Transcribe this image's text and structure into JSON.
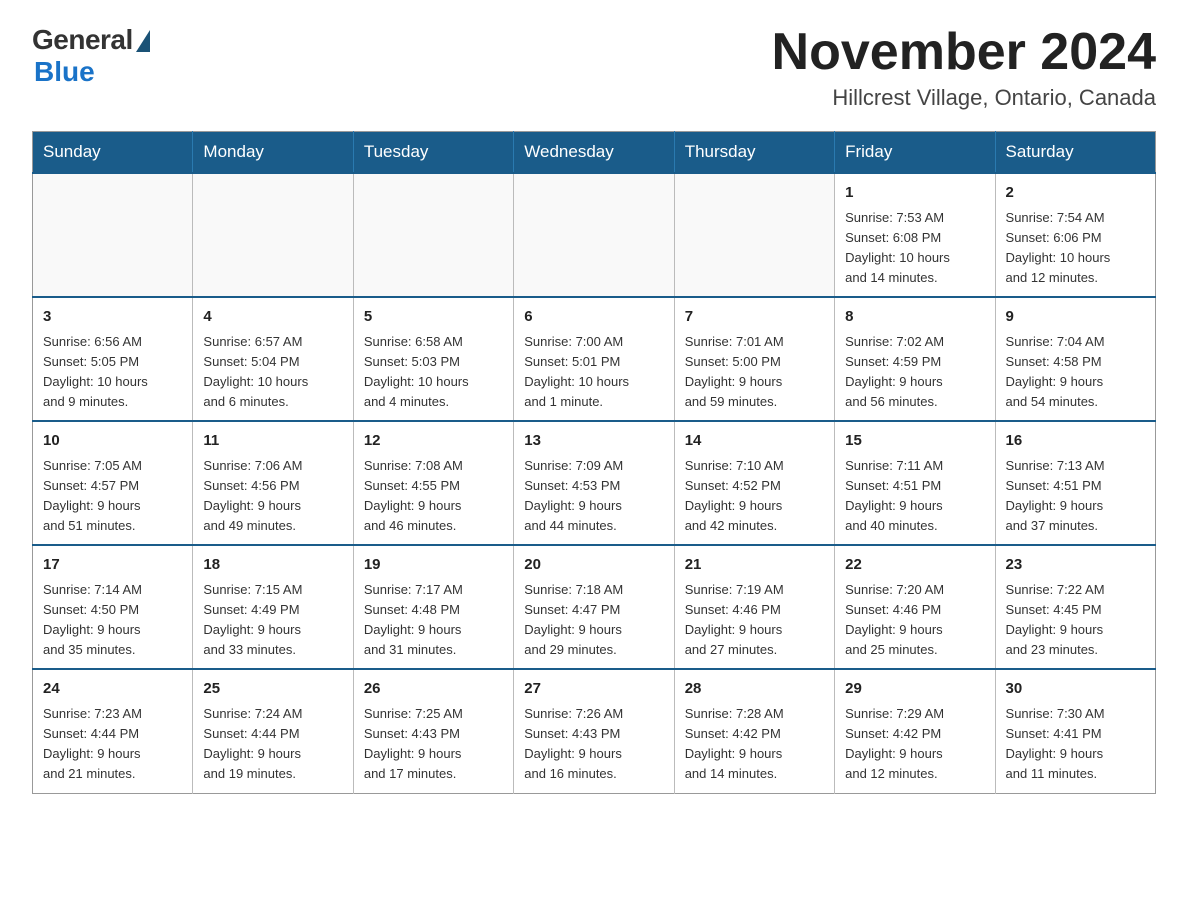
{
  "header": {
    "logo_general": "General",
    "logo_blue": "Blue",
    "month_title": "November 2024",
    "location": "Hillcrest Village, Ontario, Canada"
  },
  "weekdays": [
    "Sunday",
    "Monday",
    "Tuesday",
    "Wednesday",
    "Thursday",
    "Friday",
    "Saturday"
  ],
  "rows": [
    [
      {
        "day": "",
        "info": ""
      },
      {
        "day": "",
        "info": ""
      },
      {
        "day": "",
        "info": ""
      },
      {
        "day": "",
        "info": ""
      },
      {
        "day": "",
        "info": ""
      },
      {
        "day": "1",
        "info": "Sunrise: 7:53 AM\nSunset: 6:08 PM\nDaylight: 10 hours\nand 14 minutes."
      },
      {
        "day": "2",
        "info": "Sunrise: 7:54 AM\nSunset: 6:06 PM\nDaylight: 10 hours\nand 12 minutes."
      }
    ],
    [
      {
        "day": "3",
        "info": "Sunrise: 6:56 AM\nSunset: 5:05 PM\nDaylight: 10 hours\nand 9 minutes."
      },
      {
        "day": "4",
        "info": "Sunrise: 6:57 AM\nSunset: 5:04 PM\nDaylight: 10 hours\nand 6 minutes."
      },
      {
        "day": "5",
        "info": "Sunrise: 6:58 AM\nSunset: 5:03 PM\nDaylight: 10 hours\nand 4 minutes."
      },
      {
        "day": "6",
        "info": "Sunrise: 7:00 AM\nSunset: 5:01 PM\nDaylight: 10 hours\nand 1 minute."
      },
      {
        "day": "7",
        "info": "Sunrise: 7:01 AM\nSunset: 5:00 PM\nDaylight: 9 hours\nand 59 minutes."
      },
      {
        "day": "8",
        "info": "Sunrise: 7:02 AM\nSunset: 4:59 PM\nDaylight: 9 hours\nand 56 minutes."
      },
      {
        "day": "9",
        "info": "Sunrise: 7:04 AM\nSunset: 4:58 PM\nDaylight: 9 hours\nand 54 minutes."
      }
    ],
    [
      {
        "day": "10",
        "info": "Sunrise: 7:05 AM\nSunset: 4:57 PM\nDaylight: 9 hours\nand 51 minutes."
      },
      {
        "day": "11",
        "info": "Sunrise: 7:06 AM\nSunset: 4:56 PM\nDaylight: 9 hours\nand 49 minutes."
      },
      {
        "day": "12",
        "info": "Sunrise: 7:08 AM\nSunset: 4:55 PM\nDaylight: 9 hours\nand 46 minutes."
      },
      {
        "day": "13",
        "info": "Sunrise: 7:09 AM\nSunset: 4:53 PM\nDaylight: 9 hours\nand 44 minutes."
      },
      {
        "day": "14",
        "info": "Sunrise: 7:10 AM\nSunset: 4:52 PM\nDaylight: 9 hours\nand 42 minutes."
      },
      {
        "day": "15",
        "info": "Sunrise: 7:11 AM\nSunset: 4:51 PM\nDaylight: 9 hours\nand 40 minutes."
      },
      {
        "day": "16",
        "info": "Sunrise: 7:13 AM\nSunset: 4:51 PM\nDaylight: 9 hours\nand 37 minutes."
      }
    ],
    [
      {
        "day": "17",
        "info": "Sunrise: 7:14 AM\nSunset: 4:50 PM\nDaylight: 9 hours\nand 35 minutes."
      },
      {
        "day": "18",
        "info": "Sunrise: 7:15 AM\nSunset: 4:49 PM\nDaylight: 9 hours\nand 33 minutes."
      },
      {
        "day": "19",
        "info": "Sunrise: 7:17 AM\nSunset: 4:48 PM\nDaylight: 9 hours\nand 31 minutes."
      },
      {
        "day": "20",
        "info": "Sunrise: 7:18 AM\nSunset: 4:47 PM\nDaylight: 9 hours\nand 29 minutes."
      },
      {
        "day": "21",
        "info": "Sunrise: 7:19 AM\nSunset: 4:46 PM\nDaylight: 9 hours\nand 27 minutes."
      },
      {
        "day": "22",
        "info": "Sunrise: 7:20 AM\nSunset: 4:46 PM\nDaylight: 9 hours\nand 25 minutes."
      },
      {
        "day": "23",
        "info": "Sunrise: 7:22 AM\nSunset: 4:45 PM\nDaylight: 9 hours\nand 23 minutes."
      }
    ],
    [
      {
        "day": "24",
        "info": "Sunrise: 7:23 AM\nSunset: 4:44 PM\nDaylight: 9 hours\nand 21 minutes."
      },
      {
        "day": "25",
        "info": "Sunrise: 7:24 AM\nSunset: 4:44 PM\nDaylight: 9 hours\nand 19 minutes."
      },
      {
        "day": "26",
        "info": "Sunrise: 7:25 AM\nSunset: 4:43 PM\nDaylight: 9 hours\nand 17 minutes."
      },
      {
        "day": "27",
        "info": "Sunrise: 7:26 AM\nSunset: 4:43 PM\nDaylight: 9 hours\nand 16 minutes."
      },
      {
        "day": "28",
        "info": "Sunrise: 7:28 AM\nSunset: 4:42 PM\nDaylight: 9 hours\nand 14 minutes."
      },
      {
        "day": "29",
        "info": "Sunrise: 7:29 AM\nSunset: 4:42 PM\nDaylight: 9 hours\nand 12 minutes."
      },
      {
        "day": "30",
        "info": "Sunrise: 7:30 AM\nSunset: 4:41 PM\nDaylight: 9 hours\nand 11 minutes."
      }
    ]
  ]
}
